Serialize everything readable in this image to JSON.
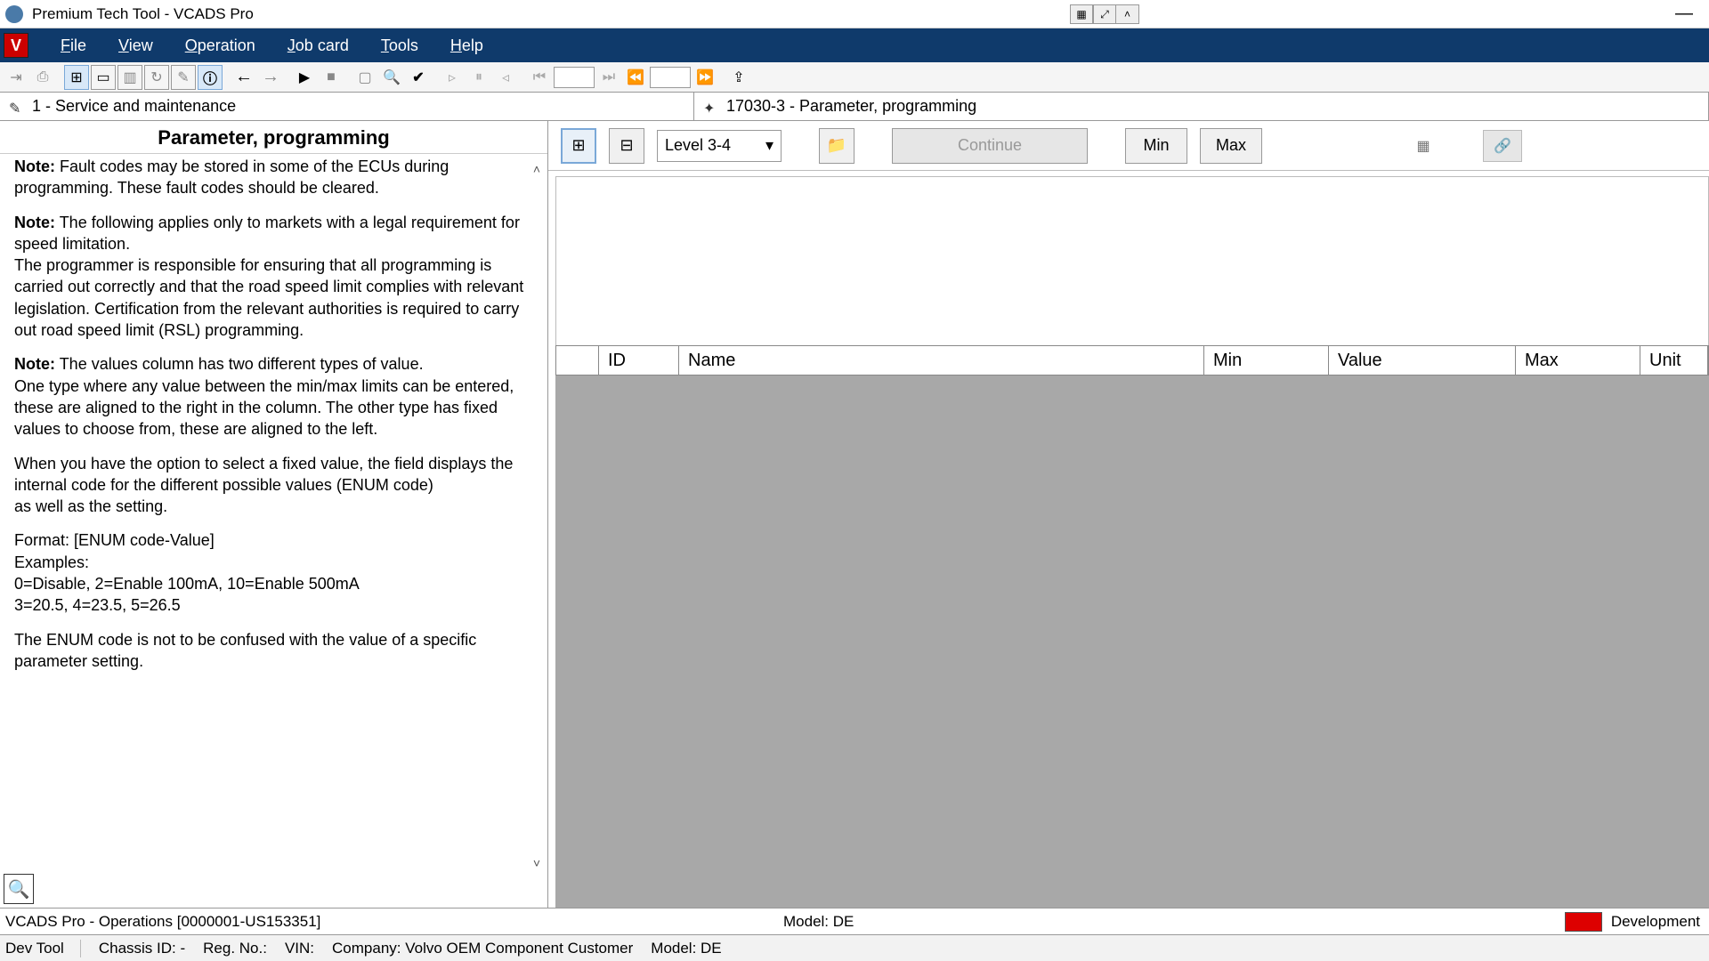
{
  "app": {
    "title": "Premium Tech Tool - VCADS Pro"
  },
  "menu": {
    "logo_letter": "V",
    "items": [
      "File",
      "View",
      "Operation",
      "Job card",
      "Tools",
      "Help"
    ]
  },
  "tabs": {
    "left": "1 - Service and maintenance",
    "right": "17030-3 - Parameter, programming"
  },
  "left_panel": {
    "heading": "Parameter, programming",
    "para_cut": "Fault codes may be stored in some of the ECUs during programming. These fault codes should be cleared.",
    "note2_line1": "The following applies only to markets with a legal requirement for speed limitation.",
    "note2_body": "The programmer is responsible for ensuring that all programming is carried out correctly and that the road speed limit complies with relevant legislation. Certification from the relevant authorities is required to carry out road speed limit (RSL) programming.",
    "note3_line1": "The values column has two different types of value.",
    "note3_body": "One type where any value between the min/max limits can be entered, these are aligned to the right in the column. The other type has fixed values to choose from, these are aligned to the left.",
    "para4a": "When you have the option to select a fixed value, the field displays the internal code for the different possible values (ENUM code)",
    "para4b": "as well as the setting.",
    "format": "Format: [ENUM code-Value]",
    "examples_label": "Examples:",
    "example1": "0=Disable, 2=Enable 100mA, 10=Enable 500mA",
    "example2": "3=20.5, 4=23.5, 5=26.5",
    "para5": "The ENUM code is not to be confused with the value of a specific parameter setting.",
    "note_label": "Note:"
  },
  "right_toolbar": {
    "level": "Level 3-4",
    "continue": "Continue",
    "min": "Min",
    "max": "Max"
  },
  "grid": {
    "columns": [
      "",
      "ID",
      "Name",
      "Min",
      "Value",
      "Max",
      "Unit"
    ]
  },
  "status1": {
    "left": "VCADS Pro - Operations   [0000001-US153351]",
    "mid": "Model: DE",
    "right": "Development"
  },
  "status2": {
    "devtool": "Dev Tool",
    "chassis": "Chassis ID: -",
    "reg": "Reg. No.:",
    "vin": "VIN:",
    "company": "Company: Volvo OEM Component Customer",
    "model": "Model: DE"
  }
}
